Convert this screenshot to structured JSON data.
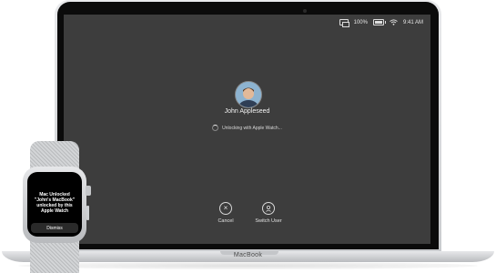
{
  "menubar": {
    "battery_percent": "100%",
    "time": "9:41 AM"
  },
  "login": {
    "user_name": "John Appleseed",
    "status": "Unlocking with Apple Watch...",
    "actions": [
      {
        "label": "Cancel",
        "icon": "cancel-icon"
      },
      {
        "label": "Switch User",
        "icon": "switch-user-icon"
      }
    ]
  },
  "laptop": {
    "brand_label": "MacBook"
  },
  "watch": {
    "message_title": "Mac Unlocked",
    "message_line2": "\"John's MacBook\"",
    "message_line3": "unlocked by this",
    "message_line4": "Apple Watch",
    "dismiss_label": "Dismiss"
  },
  "colors": {
    "screen_bg": "#3d3d3d",
    "aluminum": "#c9cbce",
    "text_light": "#f2f2f2"
  }
}
